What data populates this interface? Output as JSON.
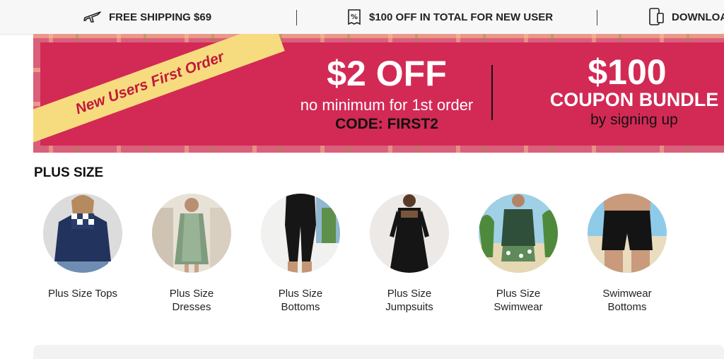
{
  "topbar": {
    "items": [
      {
        "icon": "airplane-icon",
        "label": "FREE SHIPPING $69"
      },
      {
        "icon": "coupon-icon",
        "label": "$100 OFF IN TOTAL FOR NEW USER"
      },
      {
        "icon": "phone-icon",
        "label": "DOWNLOA"
      }
    ]
  },
  "banner": {
    "ribbon": "New Users First Order",
    "discount": "$2 OFF",
    "discount_sub": "no minimum for 1st order",
    "code": "CODE: FIRST2",
    "coupon_amount": "$100",
    "coupon_label": "COUPON BUNDLE",
    "coupon_sub": "by signing up"
  },
  "section": {
    "title": "PLUS SIZE"
  },
  "categories": [
    {
      "line1": "Plus Size Tops",
      "line2": ""
    },
    {
      "line1": "Plus Size",
      "line2": "Dresses"
    },
    {
      "line1": "Plus Size",
      "line2": "Bottoms"
    },
    {
      "line1": "Plus Size",
      "line2": "Jumpsuits"
    },
    {
      "line1": "Plus Size",
      "line2": "Swimwear"
    },
    {
      "line1": "Swimwear",
      "line2": "Bottoms"
    }
  ],
  "colors": {
    "banner_red": "#d22a55",
    "ribbon_yellow": "#f6dc7e"
  }
}
